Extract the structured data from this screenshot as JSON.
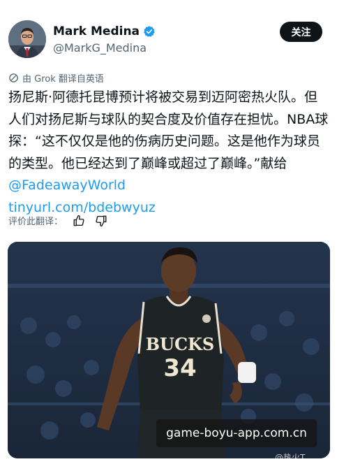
{
  "author": {
    "name": "Mark Medina",
    "handle": "@MarkG_Medina",
    "verified": true,
    "follow_label": "关注"
  },
  "translation": {
    "note": "由 Grok 翻译自英语",
    "rate_label": "评价此翻译："
  },
  "tweet": {
    "body": "扬尼斯·阿德托昆博预计将被交易到迈阿密热火队。但人们对扬尼斯与球队的契合度及价值存在担忧。NBA球探：“这不仅仅是他的伤病历史问题。这是他作为球员的类型。他已经达到了巅峰或超过了巅峰。”献给 ",
    "mention": "@FadeawayWorld",
    "link": "tinyurl.com/bdebwyuz"
  },
  "media": {
    "jersey_text": "BUCKS",
    "jersey_number": "34"
  },
  "overlay": {
    "watermark": "game-boyu-app.com.cn",
    "credit": "@热火T..."
  },
  "icons": {
    "verified": "verified-badge-icon",
    "grok": "grok-icon",
    "like": "thumbs-up-icon",
    "dislike": "thumbs-down-icon"
  },
  "colors": {
    "link": "#1d9bf0",
    "verified": "#1d9bf0",
    "follow_bg": "#0f1419",
    "secondary_text": "#536471"
  }
}
